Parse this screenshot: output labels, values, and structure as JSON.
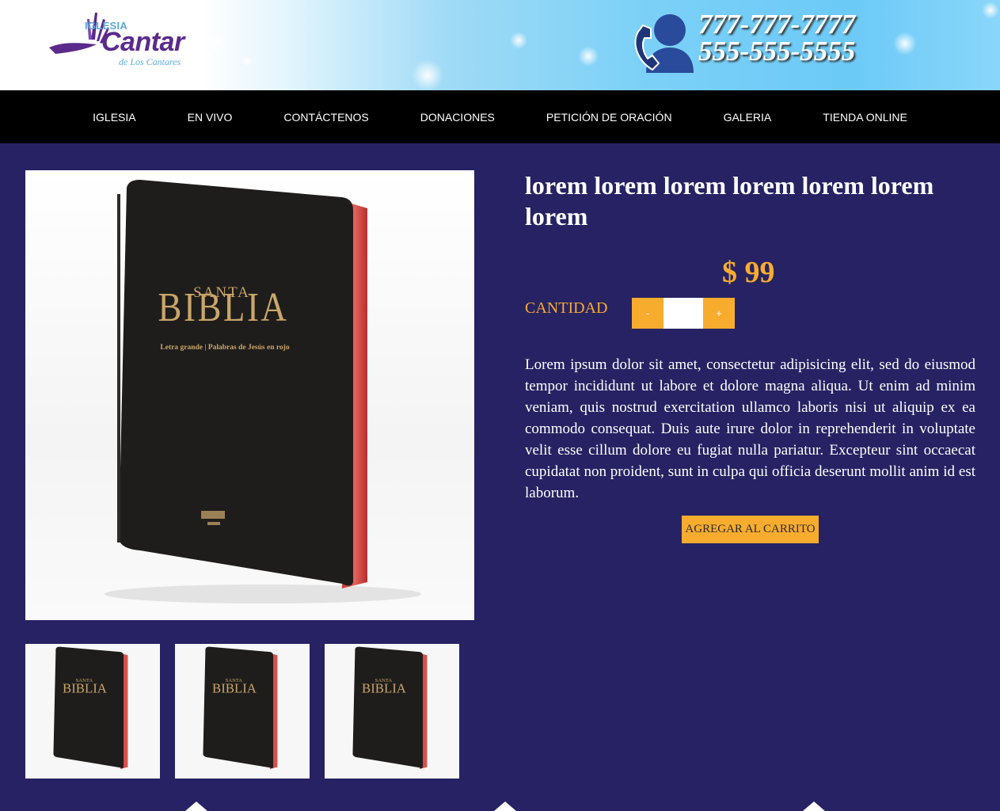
{
  "header": {
    "logo": {
      "top": "IGLESIA",
      "main": "Cantar",
      "sub": "de Los Cantares"
    },
    "phones": [
      "777-777-7777",
      "555-555-5555"
    ],
    "phone_icon": "phone-contact-icon"
  },
  "nav": {
    "items": [
      {
        "label": "IGLESIA"
      },
      {
        "label": "EN VIVO"
      },
      {
        "label": "CONTÁCTENOS"
      },
      {
        "label": "DONACIONES"
      },
      {
        "label": "PETICIÓN DE ORACIÓN"
      },
      {
        "label": "GALERIA"
      },
      {
        "label": "TIENDA ONLINE"
      }
    ]
  },
  "product": {
    "image": {
      "cover_top": "SANTA",
      "cover_title": "BIBLIA",
      "cover_sub": "Letra grande | Palabras de Jesús en rojo"
    },
    "title": "lorem lorem lorem lorem lorem lorem lorem",
    "price": "$ 99",
    "quantity_label": "CANTIDAD",
    "minus_label": "-",
    "plus_label": "+",
    "quantity_value": "",
    "description": "Lorem ipsum dolor sit amet, consectetur adipisicing elit, sed do eiusmod tempor incididunt ut labore et dolore magna aliqua. Ut enim ad minim veniam, quis nostrud exercitation ullamco laboris nisi ut aliquip ex ea commodo consequat. Duis aute irure dolor in reprehenderit in voluptate velit esse cillum dolore eu fugiat nulla pariatur. Excepteur sint occaecat cupidatat non proident, sunt in culpa qui officia deserunt mollit anim id est laborum.",
    "cart_button": "AGREGAR AL CARRITO"
  },
  "colors": {
    "background": "#262263",
    "accent": "#f8ac2e",
    "nav": "#000000"
  }
}
